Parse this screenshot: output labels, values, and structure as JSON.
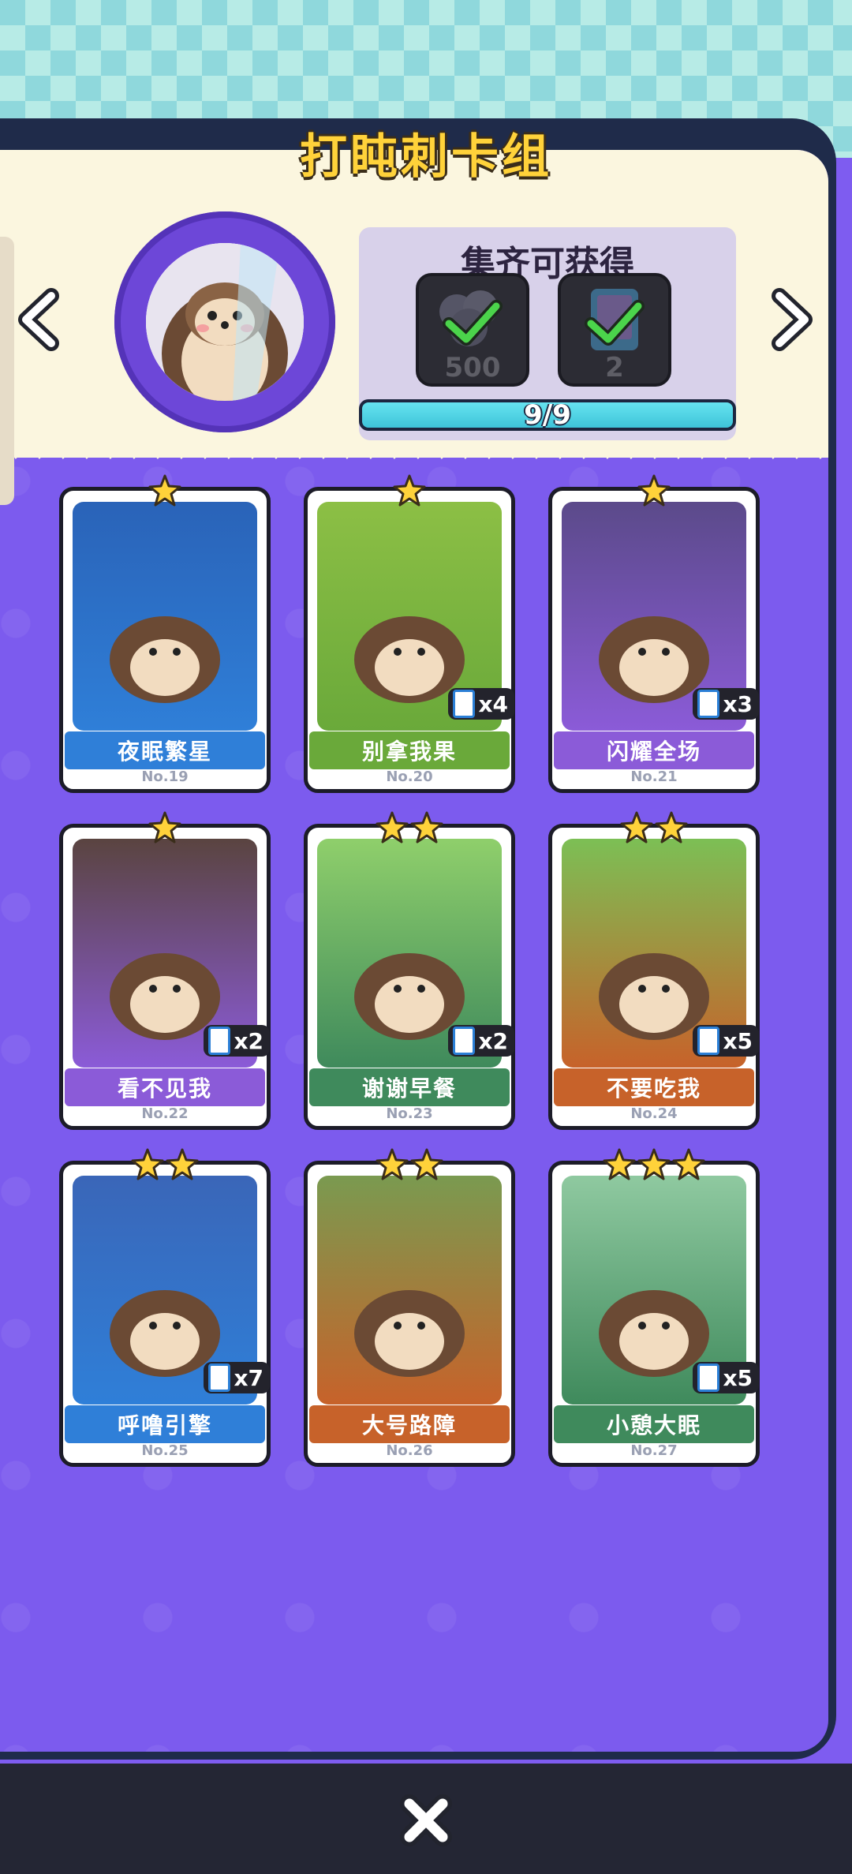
{
  "header": {
    "title": "打盹刺卡组"
  },
  "reward": {
    "title": "集齐可获得",
    "items": [
      {
        "icon": "coin-pile-icon",
        "amount": "500"
      },
      {
        "icon": "card-pack-icon",
        "amount": "2"
      }
    ],
    "progress_text": "9/9",
    "progress_fraction": 1.0
  },
  "cards": [
    {
      "name": "夜眠繁星",
      "no": "No.19",
      "stars": 1,
      "count": "",
      "theme": "#2f7fd8",
      "art": "#2a63b8"
    },
    {
      "name": "别拿我果",
      "no": "No.20",
      "stars": 1,
      "count": "x4",
      "theme": "#6aa93a",
      "art": "#8cbf45"
    },
    {
      "name": "闪耀全场",
      "no": "No.21",
      "stars": 1,
      "count": "x3",
      "theme": "#8b5bd8",
      "art": "#5b4a8a"
    },
    {
      "name": "看不见我",
      "no": "No.22",
      "stars": 1,
      "count": "x2",
      "theme": "#8b5bd8",
      "art": "#5a4440"
    },
    {
      "name": "谢谢早餐",
      "no": "No.23",
      "stars": 2,
      "count": "x2",
      "theme": "#3f8a5c",
      "art": "#8fcf6b"
    },
    {
      "name": "不要吃我",
      "no": "No.24",
      "stars": 2,
      "count": "x5",
      "theme": "#c7622a",
      "art": "#7cbf55"
    },
    {
      "name": "呼噜引擎",
      "no": "No.25",
      "stars": 2,
      "count": "x7",
      "theme": "#2f7fd8",
      "art": "#3a66b8"
    },
    {
      "name": "大号路障",
      "no": "No.26",
      "stars": 2,
      "count": "",
      "theme": "#c7622a",
      "art": "#7a9a50"
    },
    {
      "name": "小憩大眠",
      "no": "No.27",
      "stars": 3,
      "count": "x5",
      "theme": "#3f8a5c",
      "art": "#8fc9a0"
    }
  ],
  "colors": {
    "panel": "#7c5bee",
    "title": "#ffd23a",
    "progress": "#3ec4d9"
  }
}
